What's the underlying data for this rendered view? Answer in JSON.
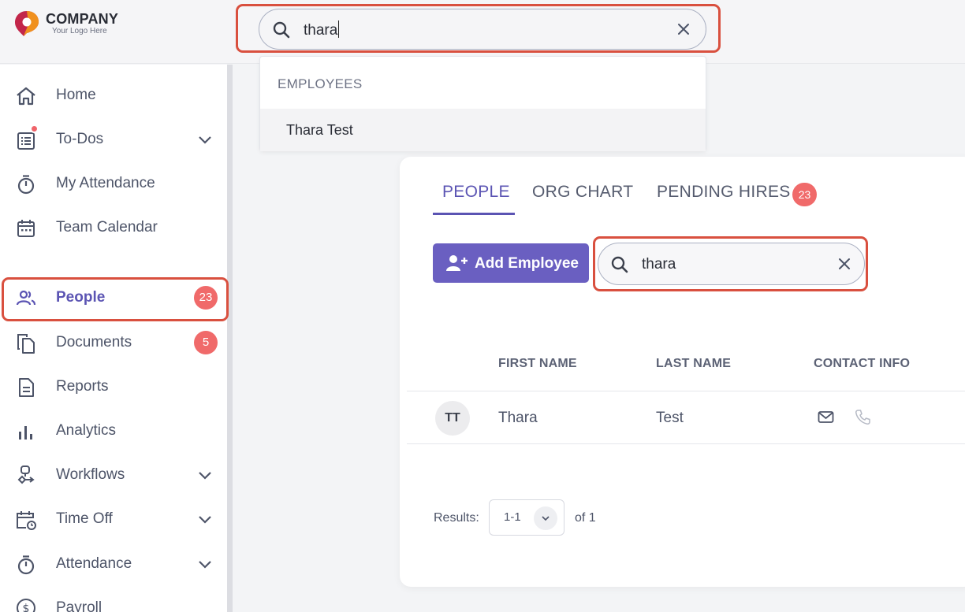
{
  "brand": {
    "name": "COMPANY",
    "tagline": "Your Logo Here",
    "accent": "#5b54b3",
    "badge_color": "#f06a6a",
    "highlight_color": "#d9503f"
  },
  "global_search": {
    "value": "thara",
    "icon": "search-icon",
    "clear_icon": "close-icon"
  },
  "search_dropdown": {
    "section_title": "EMPLOYEES",
    "results": [
      {
        "label": "Thara Test"
      }
    ]
  },
  "sidebar": {
    "items": [
      {
        "label": "Home",
        "icon": "home-icon"
      },
      {
        "label": "To-Dos",
        "icon": "todo-list-icon",
        "has_notification_dot": true,
        "expandable": true
      },
      {
        "label": "My Attendance",
        "icon": "stopwatch-icon"
      },
      {
        "label": "Team Calendar",
        "icon": "calendar-icon"
      },
      {
        "label": "People",
        "icon": "people-icon",
        "badge": "23",
        "active": true
      },
      {
        "label": "Documents",
        "icon": "documents-icon",
        "badge": "5"
      },
      {
        "label": "Reports",
        "icon": "report-icon"
      },
      {
        "label": "Analytics",
        "icon": "bar-chart-icon"
      },
      {
        "label": "Workflows",
        "icon": "workflow-icon",
        "expandable": true
      },
      {
        "label": "Time Off",
        "icon": "calendar-clock-icon",
        "expandable": true
      },
      {
        "label": "Attendance",
        "icon": "stopwatch-icon",
        "expandable": true
      },
      {
        "label": "Payroll",
        "icon": "dollar-icon"
      }
    ]
  },
  "tabs": [
    {
      "label": "PEOPLE",
      "active": true
    },
    {
      "label": "ORG CHART"
    },
    {
      "label": "PENDING HIRES",
      "badge": "23"
    }
  ],
  "toolbar": {
    "add_label": "Add Employee",
    "add_icon": "add-user-icon",
    "search_value": "thara"
  },
  "table": {
    "columns": [
      "FIRST NAME",
      "LAST NAME",
      "CONTACT INFO"
    ],
    "rows": [
      {
        "initials": "TT",
        "first_name": "Thara",
        "last_name": "Test",
        "contact_icons": [
          "mail-icon",
          "phone-icon"
        ]
      }
    ]
  },
  "pagination": {
    "label": "Results:",
    "range": "1-1",
    "of_label": "of 1"
  }
}
